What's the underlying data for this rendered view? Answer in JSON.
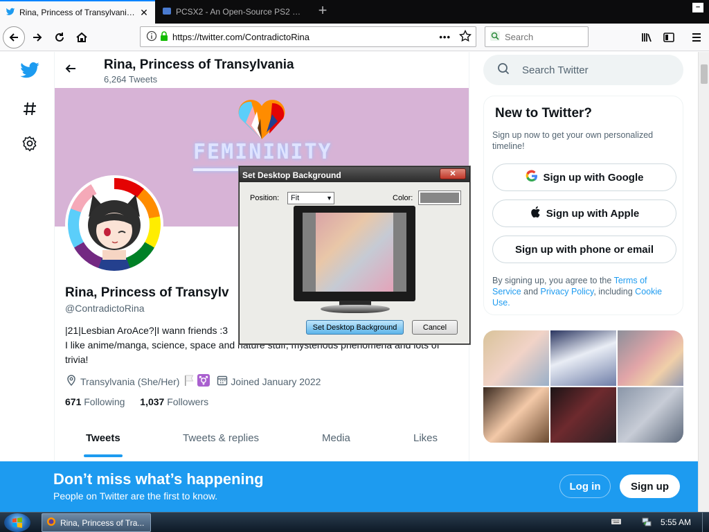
{
  "browser": {
    "tabs": [
      {
        "title": "Rina, Princess of Transylvania (@",
        "active": true
      },
      {
        "title": "PCSX2 - An Open-Source PS2 Em",
        "active": false
      }
    ],
    "url": "https://twitter.com/ContradictoRina",
    "search_placeholder": "Search"
  },
  "header": {
    "name": "Rina, Princess of Transylvania",
    "tweet_count": "6,264 Tweets"
  },
  "banner": {
    "text": "FEMININITY"
  },
  "profile": {
    "name": "Rina, Princess of Transylv",
    "handle": "@ContradictoRina",
    "bio_line1": "|21|Lesbian AroAce?|I wann friends :3",
    "bio_line2": "I like anime/manga, science, space and nature stuff, mysterious phenomena and lots of trivia!",
    "location": "Transylvania (She/Her)",
    "joined": "Joined January 2022",
    "following_count": "671",
    "following_label": "Following",
    "followers_count": "1,037",
    "followers_label": "Followers"
  },
  "profile_tabs": [
    "Tweets",
    "Tweets & replies",
    "Media",
    "Likes"
  ],
  "right": {
    "search_placeholder": "Search Twitter",
    "new_title": "New to Twitter?",
    "new_sub": "Sign up now to get your own personalized timeline!",
    "btn_google": "Sign up with Google",
    "btn_apple": "Sign up with Apple",
    "btn_phone": "Sign up with phone or email",
    "legal_prefix": "By signing up, you agree to the",
    "terms": "Terms of Service",
    "and": "and",
    "privacy": "Privacy Policy",
    "including": ", including",
    "cookie": "Cookie Use."
  },
  "bottom_bar": {
    "title": "Don’t miss what’s happening",
    "subtitle": "People on Twitter are the first to know.",
    "login": "Log in",
    "signup": "Sign up"
  },
  "dialog": {
    "title": "Set Desktop Background",
    "position_label": "Position:",
    "position_value": "Fit",
    "color_label": "Color:",
    "color_value": "#878787",
    "set_button": "Set Desktop Background",
    "cancel_button": "Cancel"
  },
  "taskbar": {
    "task_title": "Rina, Princess of Tra...",
    "clock": "5:55 AM"
  },
  "colors": {
    "twitter_blue": "#1d9bf0",
    "banner_bg": "#d7b3d6"
  }
}
